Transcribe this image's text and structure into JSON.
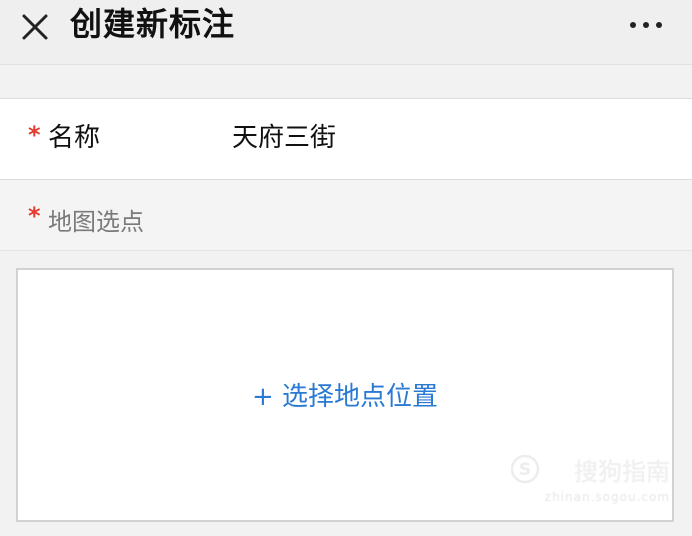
{
  "header": {
    "title": "创建新标注",
    "close_icon": "close-icon",
    "more_icon": "more-dots-icon"
  },
  "form": {
    "required_mark": "*",
    "name_label": "名称",
    "name_value": "天府三街",
    "map_label": "地图选点",
    "map_picker_text": "+ 选择地点位置"
  },
  "watermark": {
    "main": "搜狗指南",
    "sub": "zhinan.sogou.com"
  },
  "colors": {
    "required": "#e23b2e",
    "accent": "#2a7ad4",
    "header_bg": "#efefef"
  }
}
